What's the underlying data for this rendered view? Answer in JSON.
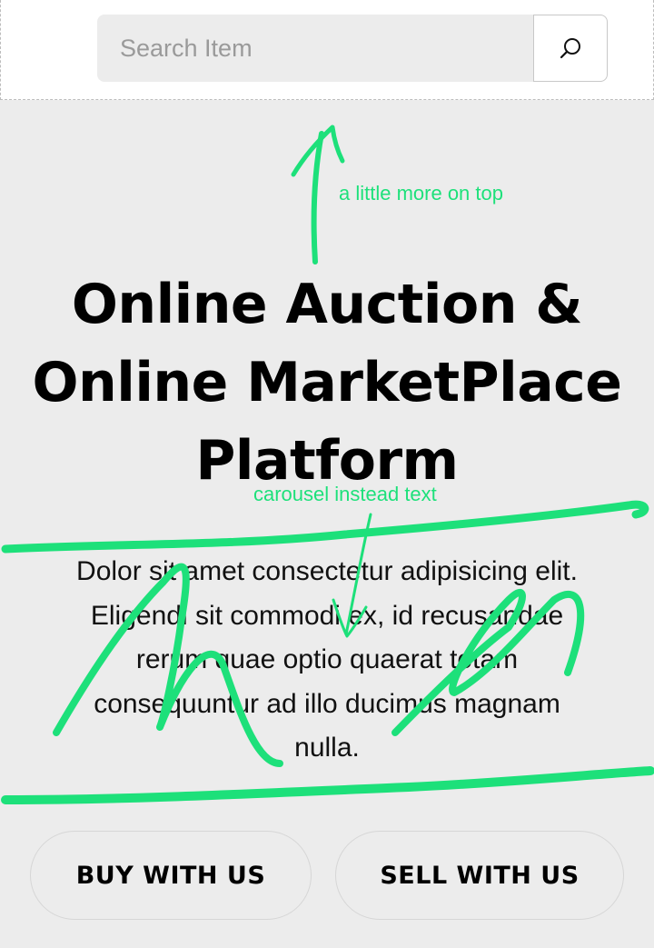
{
  "search": {
    "placeholder": "Search Item",
    "value": "",
    "button_icon": "search-icon"
  },
  "hero": {
    "title_lines": [
      "Online Auction &",
      "Online MarketPlace",
      "Platform"
    ],
    "body_lines": [
      "Dolor sit amet consectetur adipisicing elit.",
      "Eligendi sit commodi ex, id recusandae",
      "rerum quae optio quaerat totam",
      "consequuntur ad illo ducimus magnam",
      "nulla."
    ]
  },
  "buttons": {
    "buy_label": "BUY WITH US",
    "sell_label": "SELL WITH US"
  },
  "annotations": {
    "top_note": "a little more on top",
    "carousel_note": "carousel instead text",
    "ink_color": "#1de07a"
  },
  "colors": {
    "page_background": "#ececec",
    "topbar_background": "#ffffff",
    "text": "#000000"
  }
}
